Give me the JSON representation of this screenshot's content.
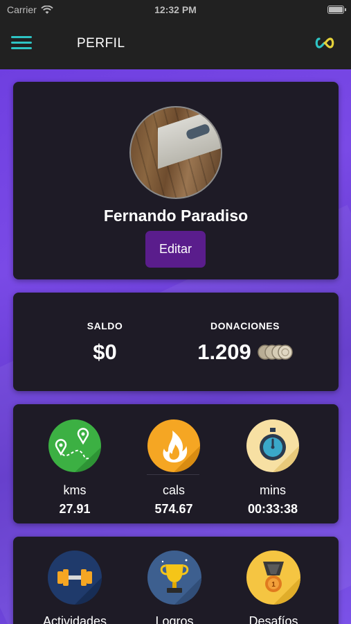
{
  "status_bar": {
    "carrier": "Carrier",
    "time": "12:32 PM"
  },
  "header": {
    "title": "PERFIL"
  },
  "profile": {
    "name": "Fernando Paradiso",
    "edit_label": "Editar"
  },
  "balance": {
    "saldo_label": "SALDO",
    "saldo_value": "$0",
    "donaciones_label": "DONACIONES",
    "donaciones_value": "1.209"
  },
  "stats": [
    {
      "label": "kms",
      "value": "27.91",
      "icon": "route-map-icon"
    },
    {
      "label": "cals",
      "value": "574.67",
      "icon": "flame-icon"
    },
    {
      "label": "mins",
      "value": "00:33:38",
      "icon": "stopwatch-icon"
    }
  ],
  "menu": [
    {
      "label": "Actividades",
      "icon": "dumbbell-icon"
    },
    {
      "label": "Logros",
      "icon": "trophy-icon"
    },
    {
      "label": "Desafíos",
      "icon": "medal-icon"
    }
  ],
  "colors": {
    "accent": "#2ec4c4",
    "background_gradient": "#6f3fe0",
    "card": "#1e1b26",
    "edit_button": "#5a1d8c"
  }
}
